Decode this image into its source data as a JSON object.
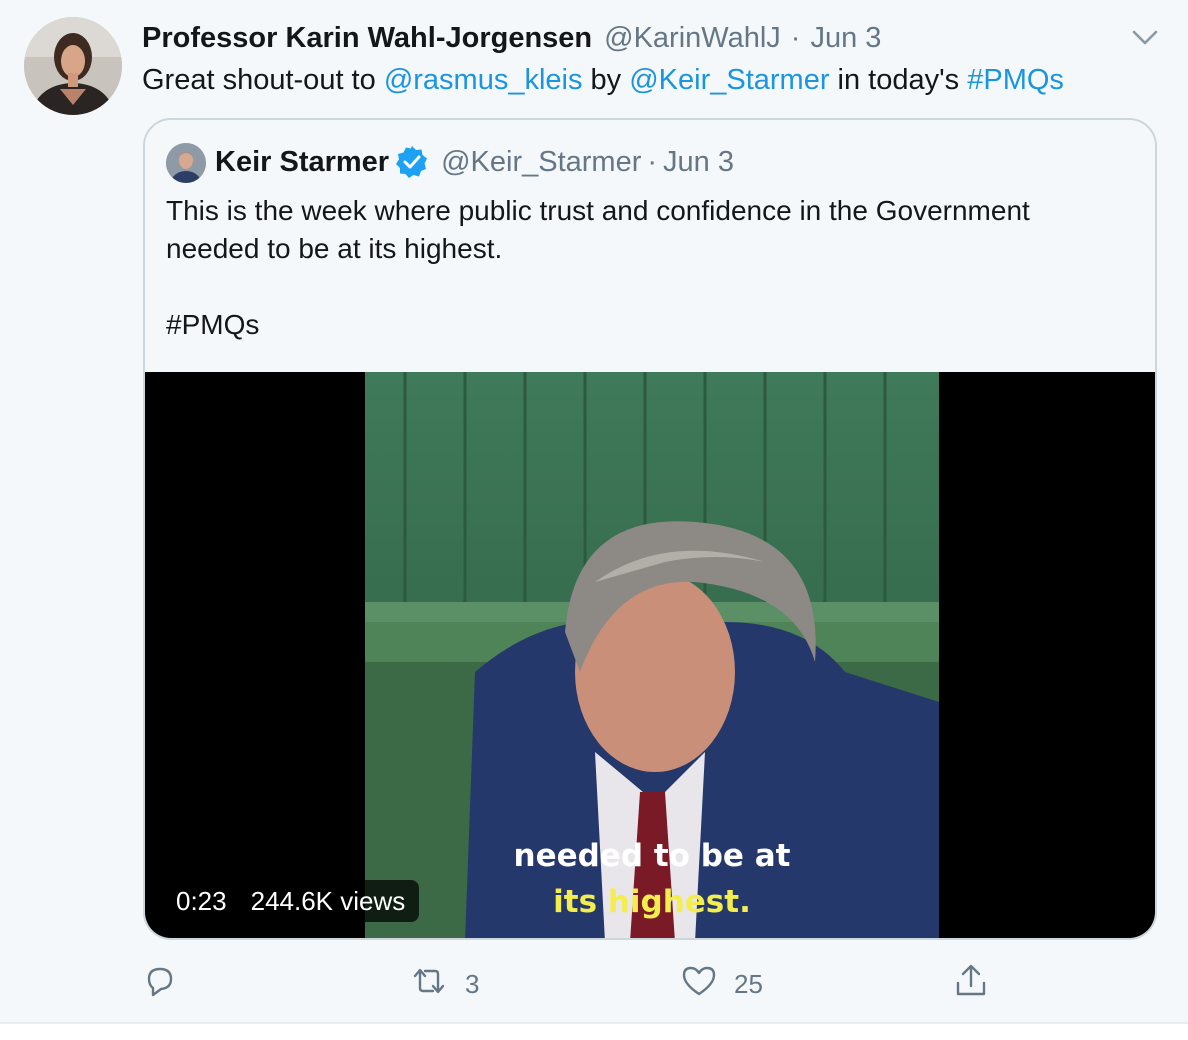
{
  "tweet": {
    "author_name": "Professor Karin Wahl-Jorgensen",
    "author_handle": "@KarinWahlJ",
    "separator": "·",
    "date": "Jun 3",
    "text": {
      "part1": "Great shout-out to ",
      "mention1": "@rasmus_kleis",
      "part2": " by ",
      "mention2": "@Keir_Starmer",
      "part3": " in today's ",
      "hashtag": "#PMQs"
    }
  },
  "quoted": {
    "author_name": "Keir Starmer",
    "author_handle": "@Keir_Starmer",
    "separator": "·",
    "date": "Jun 3",
    "line1": "This is the week where public trust and confidence in the Government",
    "line2": "needed to be at its highest.",
    "hashtag": "#PMQs",
    "video": {
      "caption_line1": "needed to be at",
      "caption_line2": "its highest.",
      "duration": "0:23",
      "views": "244.6K views"
    }
  },
  "actions": {
    "reply_icon": "reply-icon",
    "retweet_icon": "retweet-icon",
    "retweet_count": "3",
    "like_icon": "heart-icon",
    "like_count": "25",
    "share_icon": "share-icon"
  },
  "colors": {
    "link": "#1b95e0",
    "secondary_text": "#657786",
    "background": "#f5f8fa",
    "verified": "#1da1f2",
    "caption_highlight": "#f3ee4e"
  }
}
